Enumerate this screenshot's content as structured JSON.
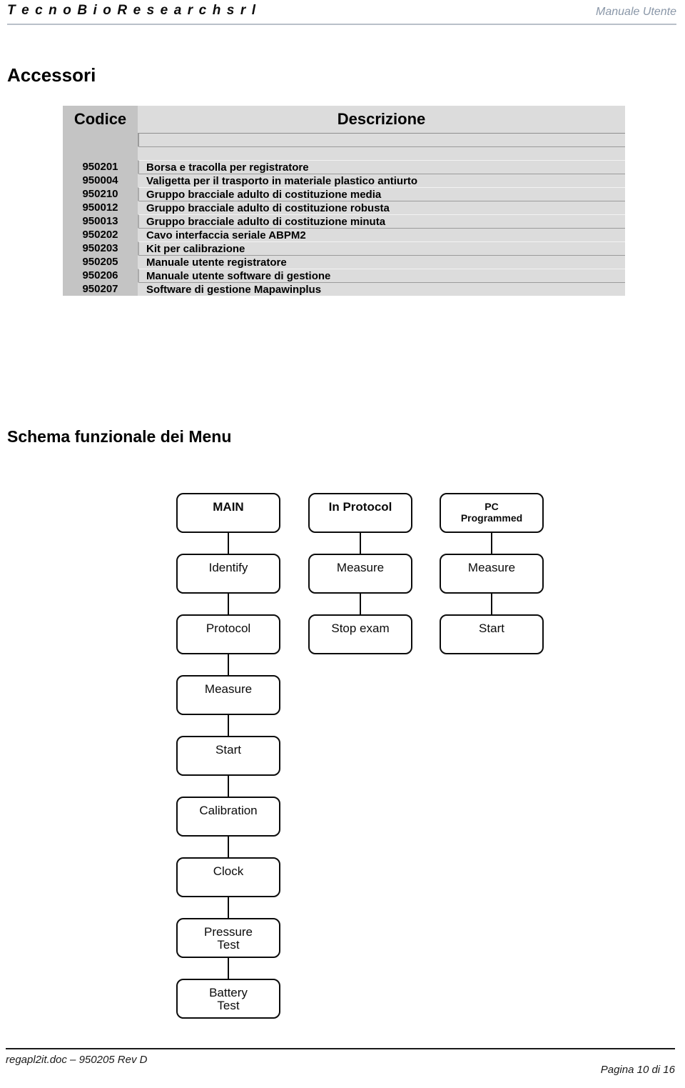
{
  "header": {
    "company": "T e c n o B i o R e s e a r c h   s r l",
    "doc_type": "Manuale Utente",
    "rule_color": "#b9c0c9",
    "doc_type_color": "#8a97a8"
  },
  "sections": {
    "accessori_title": "Accessori",
    "schema_title": "Schema funzionale dei Menu"
  },
  "table": {
    "columns": {
      "code": "Codice",
      "description": "Descrizione"
    },
    "header_code_bg": "#c4c4c4",
    "header_desc_bg": "#dcdcdc",
    "rows": [
      {
        "code": "950201",
        "description": "Borsa e tracolla per registratore"
      },
      {
        "code": "950004",
        "description": "Valigetta per il trasporto in materiale plastico antiurto"
      },
      {
        "code": "950210",
        "description": "Gruppo bracciale adulto di costituzione media"
      },
      {
        "code": "950012",
        "description": "Gruppo bracciale adulto di costituzione robusta"
      },
      {
        "code": "950013",
        "description": "Gruppo bracciale adulto di costituzione minuta"
      },
      {
        "code": "950202",
        "description": "Cavo interfaccia seriale ABPM2"
      },
      {
        "code": "950203",
        "description": "Kit per calibrazione"
      },
      {
        "code": "950205",
        "description": "Manuale utente registratore"
      },
      {
        "code": "950206",
        "description": "Manuale utente software di gestione"
      },
      {
        "code": "950207",
        "description": "Software di gestione Mapawinplus"
      }
    ]
  },
  "flowchart": {
    "columns": [
      {
        "id": "main",
        "nodes": [
          {
            "label": "MAIN",
            "style": "bold"
          },
          {
            "label": "Identify",
            "style": "normal"
          },
          {
            "label": "Protocol",
            "style": "normal"
          },
          {
            "label": "Measure",
            "style": "normal"
          },
          {
            "label": "Start",
            "style": "normal"
          },
          {
            "label": "Calibration",
            "style": "normal"
          },
          {
            "label": "Clock",
            "style": "normal"
          },
          {
            "label": "Pressure\nTest",
            "style": "normal"
          },
          {
            "label": "Battery\nTest",
            "style": "normal"
          }
        ]
      },
      {
        "id": "in-protocol",
        "nodes": [
          {
            "label": "In Protocol",
            "style": "bold"
          },
          {
            "label": "Measure",
            "style": "normal"
          },
          {
            "label": "Stop exam",
            "style": "normal"
          }
        ]
      },
      {
        "id": "pc-programmed",
        "nodes": [
          {
            "label": "PC\nProgrammed",
            "style": "small"
          },
          {
            "label": "Measure",
            "style": "normal"
          },
          {
            "label": "Start",
            "style": "normal"
          }
        ]
      }
    ]
  },
  "footer": {
    "document_ref": "regapl2it.doc – 950205 Rev D",
    "page_number": "Pagina 10 di 16"
  }
}
